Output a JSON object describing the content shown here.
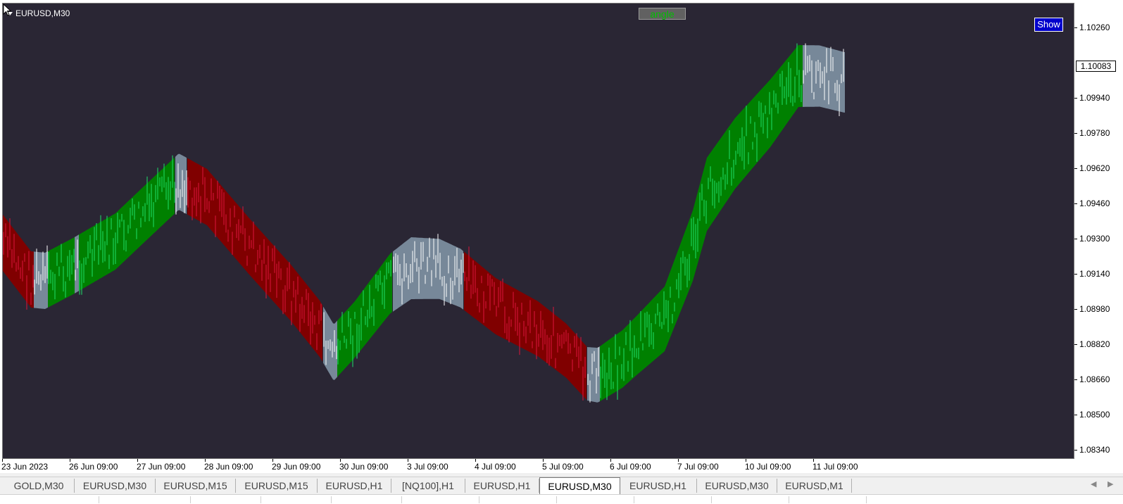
{
  "chart": {
    "symbol": "EURUSD,M30",
    "angle_label": "angle",
    "show_label": "Show",
    "current_price": "1.10083",
    "price_labels": [
      "1.10260",
      "1.09940",
      "1.09780",
      "1.09620",
      "1.09460",
      "1.09300",
      "1.09140",
      "1.08980",
      "1.08820",
      "1.08660",
      "1.08500",
      "1.08340"
    ],
    "time_labels": [
      "23 Jun 2023",
      "26 Jun 09:00",
      "27 Jun 09:00",
      "28 Jun 09:00",
      "29 Jun 09:00",
      "30 Jun 09:00",
      "3 Jul 09:00",
      "4 Jul 09:00",
      "5 Jul 09:00",
      "6 Jul 09:00",
      "7 Jul 09:00",
      "10 Jul 09:00",
      "11 Jul 09:00"
    ],
    "colors": {
      "background": "#2a2634",
      "band_up": "#008000",
      "band_down": "#800000",
      "band_flat": "#778899",
      "candle_up": "#1ee06a",
      "candle_down": "#dc143c",
      "candle_flat": "#ffffff"
    }
  },
  "tabs": [
    {
      "label": "GOLD,M30",
      "active": false
    },
    {
      "label": "EURUSD,M30",
      "active": false
    },
    {
      "label": "EURUSD,M15",
      "active": false
    },
    {
      "label": "EURUSD,M15",
      "active": false
    },
    {
      "label": "EURUSD,H1",
      "active": false
    },
    {
      "label": "[NQ100],H1",
      "active": false
    },
    {
      "label": "EURUSD,H1",
      "active": false
    },
    {
      "label": "EURUSD,M30",
      "active": true
    },
    {
      "label": "EURUSD,H1",
      "active": false
    },
    {
      "label": "EURUSD,M30",
      "active": false
    },
    {
      "label": "EURUSD,M1",
      "active": false
    }
  ]
}
